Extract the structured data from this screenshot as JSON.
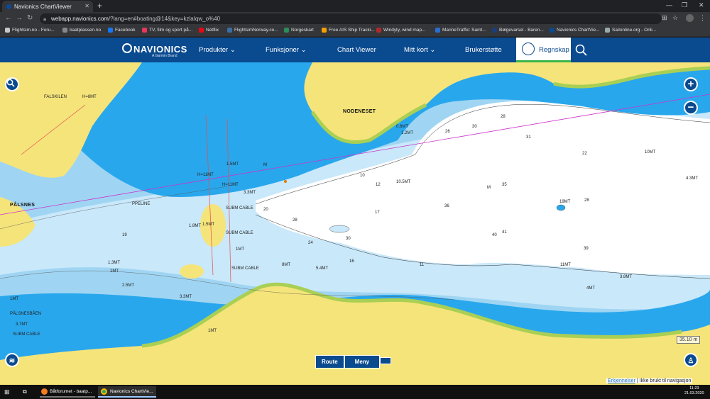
{
  "browser": {
    "tab_title": "Navionics ChartViewer",
    "url_host": "webapp.navionics.com",
    "url_path": "/?lang=en#boating@14&key=kzlaIqw_o%40",
    "bookmarks": [
      "Flightsim.no - Foru...",
      "baatplassen.no",
      "Facebook",
      "TV, film og sport på...",
      "Netflix",
      "FlightsimNorway.co...",
      "Norgeskart",
      "Free AIS Ship Tracki...",
      "Windyty, wind map...",
      "MarineTraffic: Samt...",
      "Bølgevarsel - Baren...",
      "Navionics ChartVie...",
      "Sailonline.org - Onli..."
    ]
  },
  "header": {
    "brand": "NAVIONICS",
    "sub": "A Garmin Brand",
    "nav": [
      "Produkter",
      "Funksjoner",
      "Chart Viewer",
      "Mitt kort",
      "Brukerstøtte"
    ],
    "account": "Regnskap"
  },
  "map": {
    "places": [
      "PÅLSNES",
      "NODENESET",
      "FALSKILEN",
      "PÅLSNESBÅEN",
      "PPELINE"
    ],
    "labels": [
      "SUBM CABLE",
      "SUBM CABLE",
      "SUBM CABLE",
      "SUBM CABLE",
      "H=8MT",
      "H=11MT",
      "H=11MT",
      "1.5MT",
      "3.3MT",
      "1.5MT",
      "1.8MT",
      "1MT",
      "1MT",
      "0.6MT",
      "1.2MT",
      "10.5MT",
      "19MT",
      "4MT",
      "11MT",
      "3.8MT",
      "10MT",
      "4.3MT",
      "1.3MT",
      "1MT",
      "2.5MT",
      "5.4MT",
      "8MT",
      "3.3MT",
      "1MT",
      "3.7MT",
      "28",
      "26",
      "30",
      "31",
      "35",
      "28",
      "22",
      "39",
      "41",
      "40",
      "24",
      "28",
      "30",
      "36",
      "17",
      "16",
      "12",
      "11",
      "10",
      "20",
      "19",
      "M",
      "M",
      "N0 1"
    ],
    "buttons": {
      "route": "Route",
      "menu": "Meny"
    },
    "scale": "35.10 m",
    "credits_link": "Erkjennelser",
    "credits_text": "| Ikke brukt til navigasjon"
  },
  "taskbar": {
    "items": [
      "Båtforumet - baatp...",
      "Navionics ChartVie..."
    ],
    "time": "11:23",
    "date": "21.03.2020"
  },
  "colors": {
    "land": "#f5e47a",
    "green": "#a9cf54",
    "shallow": "#29a7ec",
    "mid": "#9fd5f3",
    "light": "#c9e8fa",
    "deep": "#ffffff",
    "brand": "#0a4a8f"
  }
}
